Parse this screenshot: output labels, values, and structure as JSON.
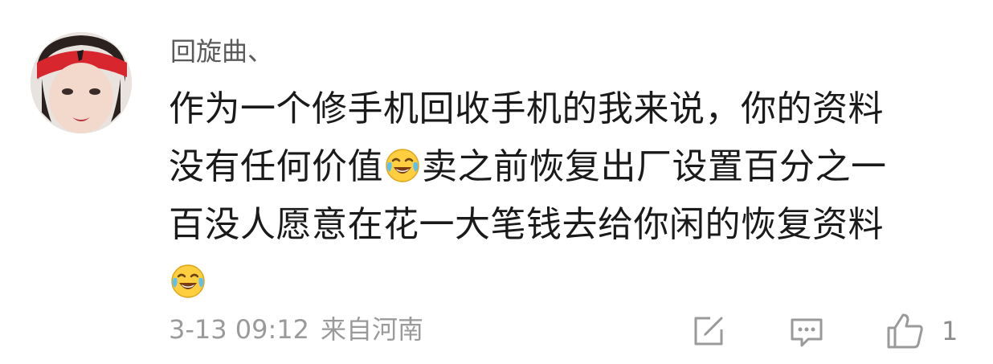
{
  "comment": {
    "username": "回旋曲、",
    "text_lines": [
      "作为一个修手机回收手机的我来说，你的资料",
      "没有任何价值",
      "卖之前恢复出厂设置百分之一",
      "百没人愿意在花一大笔钱去给你闲的恢复资料"
    ],
    "emoji": "laugh-cry-emoji",
    "timestamp": "3-13 09:12",
    "location": "来自河南",
    "like_count": "1"
  },
  "icons": {
    "share": "share-edit-icon",
    "reply": "comment-icon",
    "like": "thumbs-up-icon"
  },
  "colors": {
    "username": "#5a5a5a",
    "text": "#1a1a1a",
    "meta": "#9a9a9a",
    "icon": "#9a9a9a"
  }
}
